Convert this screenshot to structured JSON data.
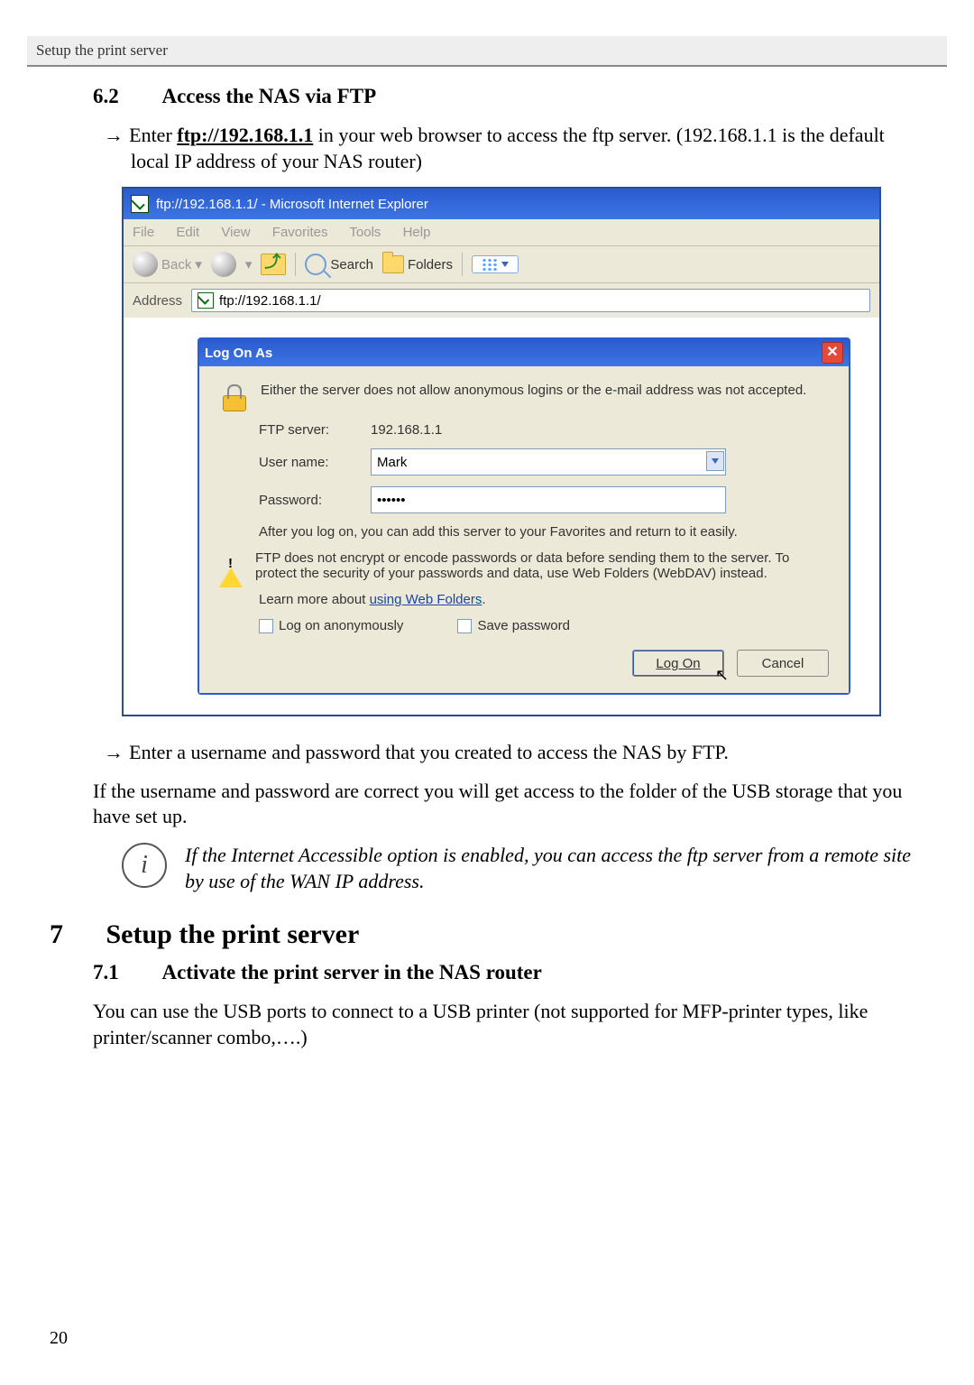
{
  "running_head": "Setup the print server",
  "section_62": {
    "number": "6.2",
    "title": "Access the NAS via FTP",
    "bullet_pre": "Enter ",
    "bullet_link": "ftp://192.168.1.1",
    "bullet_post": " in your web browser to access the ftp server. (192.168.1.1 is the default local IP address of your NAS router)"
  },
  "ie": {
    "title": "ftp://192.168.1.1/ - Microsoft Internet Explorer",
    "menu": {
      "file": "File",
      "edit": "Edit",
      "view": "View",
      "favorites": "Favorites",
      "tools": "Tools",
      "help": "Help"
    },
    "toolbar": {
      "back": "Back",
      "search": "Search",
      "folders": "Folders"
    },
    "address_label": "Address",
    "address_value": "ftp://192.168.1.1/"
  },
  "dialog": {
    "title": "Log On As",
    "msg1": "Either the server does not allow anonymous logins or the e-mail address was not accepted.",
    "ftp_label": "FTP server:",
    "ftp_value": "192.168.1.1",
    "user_label": "User name:",
    "user_value": "Mark",
    "pass_label": "Password:",
    "pass_value": "••••••",
    "msg2": "After you log on, you can add this server to your Favorites and return to it easily.",
    "warn": "FTP does not encrypt or encode passwords or data before sending them to the server.  To protect the security of your passwords and data, use Web Folders (WebDAV) instead.",
    "learn_pre": "Learn more about ",
    "learn_link": "using Web Folders",
    "learn_post": ".",
    "anon": "Log on anonymously",
    "save_pw": "Save password",
    "logon_btn": "Log On",
    "cancel_btn": "Cancel"
  },
  "after_shot": {
    "bullet": "Enter a username and password that you created to access the NAS by FTP.",
    "para": "If the username and password are correct you will get access to the folder of the USB storage that you have set up.",
    "note": "If the Internet Accessible option is enabled, you can access the ftp server from a remote site by use of the WAN IP address."
  },
  "section_7": {
    "number": "7",
    "title": "Setup the print server"
  },
  "section_71": {
    "number": "7.1",
    "title": "Activate the print server in the NAS router",
    "para": "You can use the USB ports to connect to a USB printer (not supported for MFP-printer types, like printer/scanner combo,….)"
  },
  "page_number": "20"
}
